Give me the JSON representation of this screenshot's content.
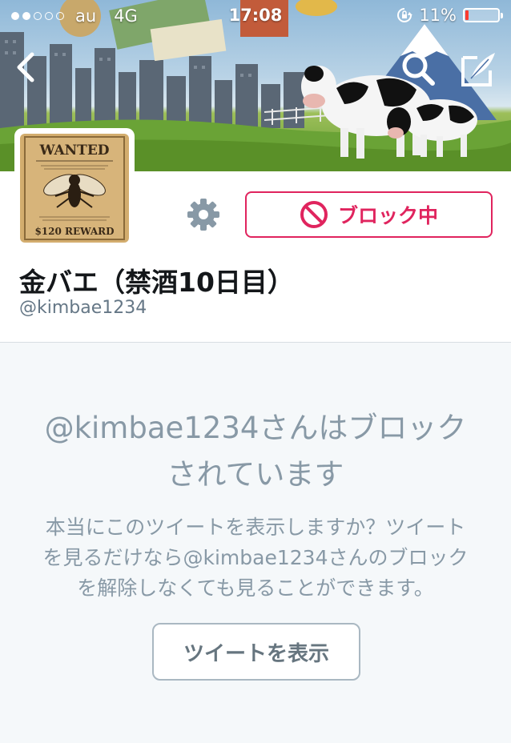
{
  "status_bar": {
    "signal_dots_filled": 2,
    "signal_dots_total": 5,
    "carrier": "au",
    "network": "4G",
    "time": "17:08",
    "battery_percent": "11%",
    "battery_level": 0.11,
    "battery_color": "#ff3b30",
    "icons": [
      "orientation-lock-icon",
      "battery-icon"
    ]
  },
  "nav": {
    "icons": [
      "back-chevron-icon",
      "search-icon",
      "compose-icon"
    ]
  },
  "profile": {
    "display_name": "金バエ（禁酒10日目）",
    "screen_name": "@kimbae1234",
    "avatar_text_top": "WANTED",
    "avatar_text_bottom": "$120 REWARD",
    "blocked_button_label": "ブロック中",
    "accent_color": "#e0245e"
  },
  "notice": {
    "title_line1": "@kimbae1234さんはブロック",
    "title_line2": "されています",
    "body_line1": "本当にこのツイートを表示しますか？ツイート",
    "body_line2": "を見るだけなら@kimbae1234さんのブロック",
    "body_line3": "を解除しなくても見ることができます。",
    "view_button_label": "ツイートを表示"
  }
}
